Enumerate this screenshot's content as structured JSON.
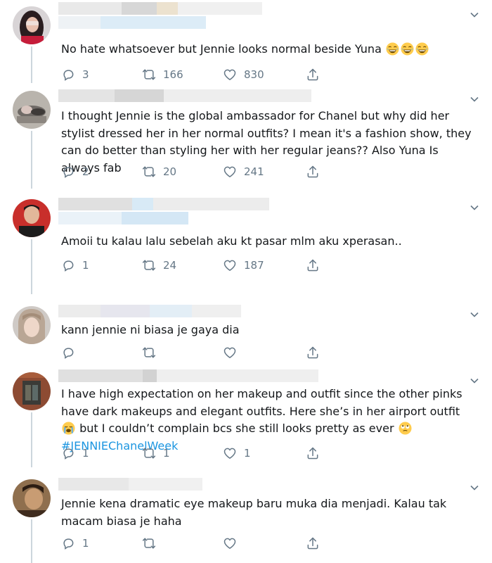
{
  "colors": {
    "text": "#14171a",
    "muted": "#657786",
    "link": "#1b95e0",
    "line": "#ccd6dd"
  },
  "icons": {
    "reply": "reply-icon",
    "retweet": "retweet-icon",
    "like": "heart-icon",
    "share": "share-icon",
    "menu": "chevron-down-icon"
  },
  "tweets": [
    {
      "text": "No hate whatsoever but Jennie looks normal beside Yuna",
      "emoji": "crying-laughing-emoji x3",
      "replies": "3",
      "retweets": "166",
      "likes": "830"
    },
    {
      "text": "I thought Jennie is the global ambassador for Chanel but why did her stylist dressed her in her normal outfits? I mean it's a fashion show, they can do better than styling her with her regular jeans?? Also Yuna Is always fab",
      "replies": "2",
      "retweets": "20",
      "likes": "241"
    },
    {
      "text": "Amoii tu kalau lalu sebelah aku kt pasar mlm aku xperasan..",
      "replies": "1",
      "retweets": "24",
      "likes": "187"
    },
    {
      "text": "kann jennie ni biasa je gaya dia",
      "replies": "",
      "retweets": "",
      "likes": ""
    },
    {
      "text_a": "I have high expectation on her makeup and outfit since the other pinks have dark makeups and elegant outfits. Here she’s in her airport outfit",
      "text_b": " but I couldn’t complain bcs she still looks pretty as ever ",
      "hashtag": "#JENNIEChanelWeek",
      "replies": "1",
      "retweets": "1",
      "likes": "1"
    },
    {
      "text": "Jennie kena dramatic eye makeup baru muka dia menjadi. Kalau tak macam biasa je haha",
      "replies": "1",
      "retweets": "",
      "likes": ""
    }
  ]
}
